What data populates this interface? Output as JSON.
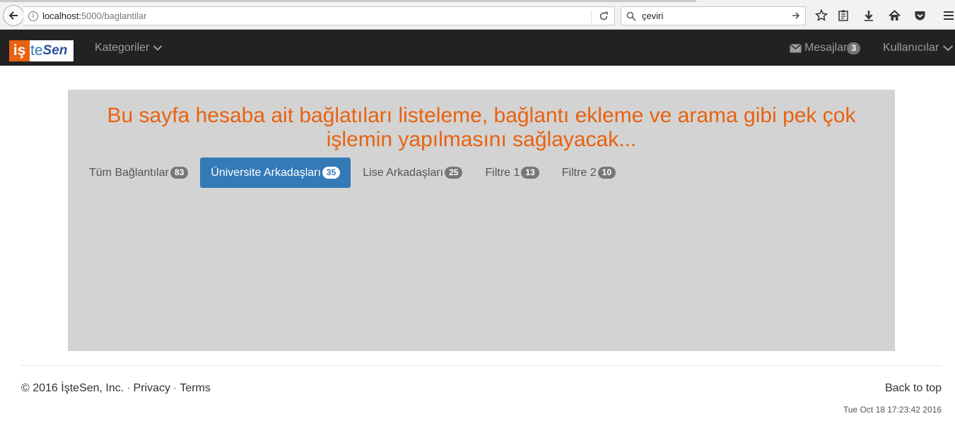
{
  "browser": {
    "url_host": "localhost:",
    "url_path": "5000/baglantilar",
    "search_value": "çeviri"
  },
  "navbar": {
    "logo_is": "iş",
    "logo_te": "te",
    "logo_sen": "Sen",
    "kategoriler": "Kategoriler",
    "mesajlar": "Mesajlar",
    "mesajlar_count": "3",
    "kullanicilar": "Kullanıcılar"
  },
  "main": {
    "headline": "Bu sayfa hesaba ait bağlatıları listeleme, bağlantı ekleme ve arama gibi pek çok işlemin yapılmasını sağlayacak...",
    "tabs": [
      {
        "label": "Tüm Bağlantılar",
        "count": "83"
      },
      {
        "label": "Üniversite Arkadaşları",
        "count": "35"
      },
      {
        "label": "Lise Arkadaşları",
        "count": "25"
      },
      {
        "label": "Filtre 1",
        "count": "13"
      },
      {
        "label": "Filtre 2",
        "count": "10"
      }
    ],
    "active_tab": "Üniversite Arkadaşları"
  },
  "footer": {
    "copyright": "© 2016 İşteSen, Inc.",
    "sep": "·",
    "privacy": "Privacy",
    "terms": "Terms",
    "back_to_top": "Back to top",
    "timestamp": "Tue Oct 18 17:23:42 2016"
  }
}
